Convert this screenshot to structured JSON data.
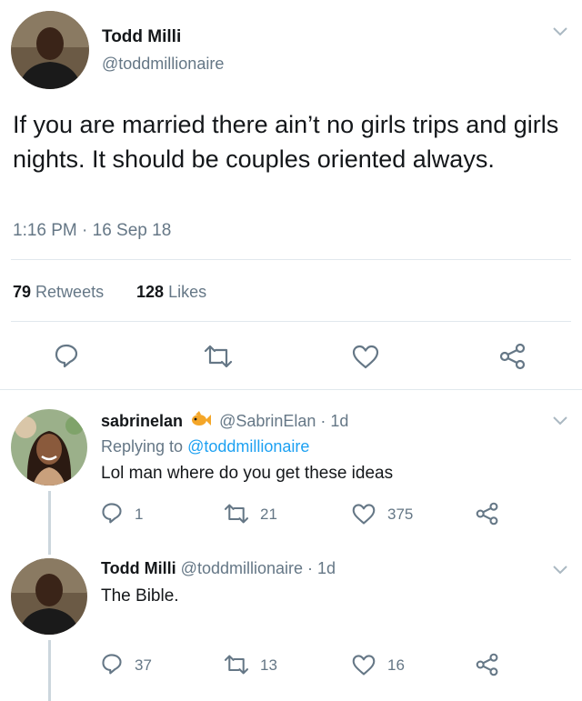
{
  "main_tweet": {
    "author_name": "Todd Milli",
    "author_handle": "@toddmillionaire",
    "text": "If you are married there ain’t no girls trips and girls nights. It should be couples oriented always.",
    "timestamp": "1:16 PM · 16 Sep 18",
    "retweets_count": "79",
    "retweets_label": "Retweets",
    "likes_count": "128",
    "likes_label": "Likes"
  },
  "replies": [
    {
      "author_name": "sabrinelan",
      "author_handle": "@SabrinElan · 1d",
      "replying_prefix": "Replying to",
      "replying_to": "@toddmillionaire",
      "text": "Lol man where do you get these ideas",
      "reply_count": "1",
      "retweet_count": "21",
      "like_count": "375"
    },
    {
      "author_name": "Todd Milli",
      "author_handle": "@toddmillionaire · 1d",
      "text": "The Bible.",
      "reply_count": "37",
      "retweet_count": "13",
      "like_count": "16"
    }
  ],
  "colors": {
    "text": "#14171a",
    "muted": "#657786",
    "link": "#1da1f2",
    "divider": "#e1e8ed",
    "thread_line": "#ccd6dd"
  },
  "icons": [
    "reply-icon",
    "retweet-icon",
    "like-icon",
    "share-icon",
    "chevron-down-icon",
    "fish-emoji-icon"
  ]
}
